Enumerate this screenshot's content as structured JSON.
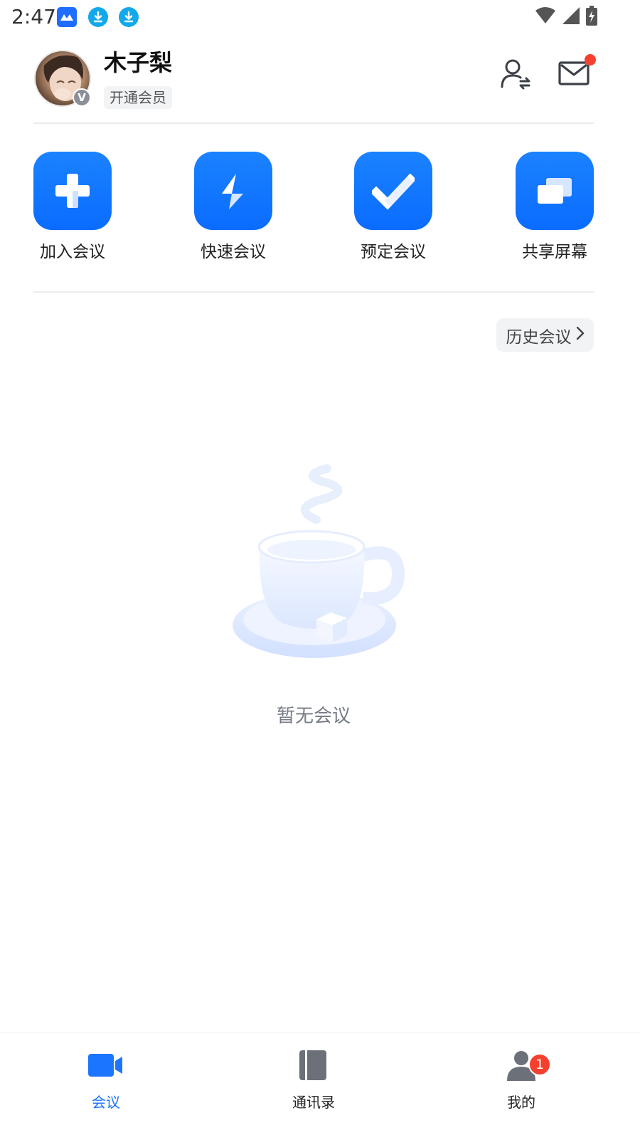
{
  "status_bar": {
    "time": "2:47",
    "left_icons": [
      "app-logo-icon",
      "download-icon",
      "download-icon"
    ],
    "right_icons": [
      "wifi-icon",
      "signal-icon",
      "battery-charging-icon"
    ]
  },
  "header": {
    "user_name": "木子梨",
    "avatar_badge": "V",
    "member_tag": "开通会员",
    "icons": [
      "switch-account-icon",
      "mail-icon"
    ],
    "mail_has_unread": true
  },
  "actions": [
    {
      "label": "加入会议",
      "icon": "plus-icon"
    },
    {
      "label": "快速会议",
      "icon": "lightning-icon"
    },
    {
      "label": "预定会议",
      "icon": "checkmark-icon"
    },
    {
      "label": "共享屏幕",
      "icon": "share-screen-icon"
    }
  ],
  "history": {
    "label": "历史会议"
  },
  "empty_state": {
    "text": "暂无会议",
    "illustration": "coffee-cup-illustration"
  },
  "bottom_nav": {
    "items": [
      {
        "label": "会议",
        "icon": "video-camera-icon",
        "active": true
      },
      {
        "label": "通讯录",
        "icon": "contacts-book-icon",
        "active": false
      },
      {
        "label": "我的",
        "icon": "person-icon",
        "active": false,
        "badge": "1"
      }
    ]
  },
  "colors": {
    "accent": "#1B75FF",
    "badge_red": "#F5402F",
    "text_secondary": "#767B85"
  }
}
